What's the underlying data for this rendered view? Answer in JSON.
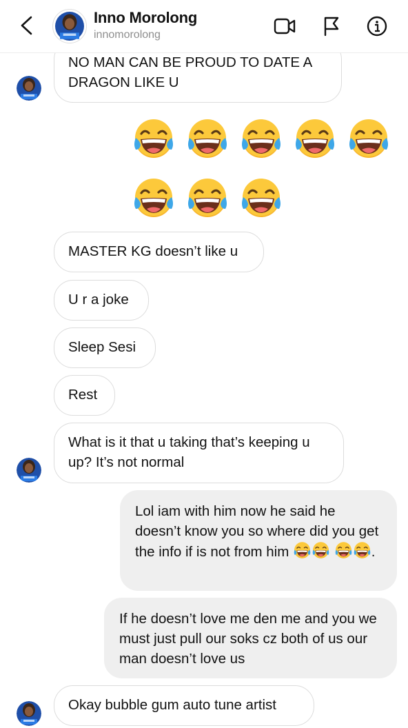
{
  "header": {
    "name": "Inno Morolong",
    "username": "innomorolong"
  },
  "icons": {
    "back": "chevron-left-icon",
    "video": "video-camera-icon",
    "report": "flag-icon",
    "info": "info-icon",
    "emoji": "face-with-tears-of-joy"
  },
  "colors": {
    "outgoing_bubble": "#efefef",
    "incoming_border": "#dcdcdc",
    "emoji_yellow": "#f7b52c",
    "tear_blue": "#3ea7e8"
  },
  "messages": [
    {
      "direction": "in",
      "text": "NO MAN CAN BE PROUD TO DATE A DRAGON LIKE U"
    },
    {
      "direction": "in",
      "text": "MASTER KG doesn’t like u"
    },
    {
      "direction": "in",
      "text": "U r a joke"
    },
    {
      "direction": "in",
      "text": "Sleep Sesi"
    },
    {
      "direction": "in",
      "text": "Rest"
    },
    {
      "direction": "in",
      "text": "What is it that u taking that’s keeping u up? It’s not normal"
    },
    {
      "direction": "out",
      "text": "Lol iam with him now he said he doesn’t know you so where did you get the info if is not from him",
      "trailing": "."
    },
    {
      "direction": "out",
      "text": "If he doesn’t love me den me and you we must just pull our soks cz both of us our man doesn’t love us"
    },
    {
      "direction": "in",
      "text": "Okay bubble gum auto tune artist"
    }
  ]
}
